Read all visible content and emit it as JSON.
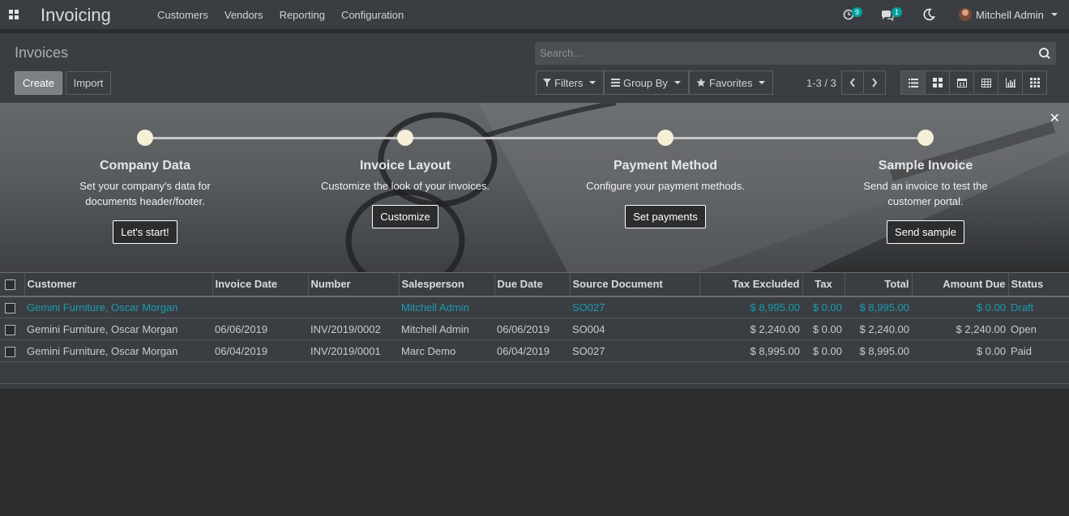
{
  "navbar": {
    "app_title": "Invoicing",
    "menu": [
      "Customers",
      "Vendors",
      "Reporting",
      "Configuration"
    ],
    "activity_count": "9",
    "message_count": "1",
    "user_name": "Mitchell Admin"
  },
  "control_panel": {
    "breadcrumb": "Invoices",
    "create_label": "Create",
    "import_label": "Import",
    "search_placeholder": "Search...",
    "filters_label": "Filters",
    "group_by_label": "Group By",
    "favorites_label": "Favorites",
    "pager": "1-3 / 3"
  },
  "onboarding": {
    "steps": [
      {
        "title": "Company Data",
        "desc": "Set your company's data for documents header/footer.",
        "button": "Let's start!"
      },
      {
        "title": "Invoice Layout",
        "desc": "Customize the look of your invoices.",
        "button": "Customize"
      },
      {
        "title": "Payment Method",
        "desc": "Configure your payment methods.",
        "button": "Set payments"
      },
      {
        "title": "Sample Invoice",
        "desc": "Send an invoice to test the customer portal.",
        "button": "Send sample"
      }
    ]
  },
  "table": {
    "columns": [
      "Customer",
      "Invoice Date",
      "Number",
      "Salesperson",
      "Due Date",
      "Source Document",
      "Tax Excluded",
      "Tax",
      "Total",
      "Amount Due",
      "Status"
    ],
    "rows": [
      [
        "Gemini Furniture, Oscar Morgan",
        "",
        "",
        "Mitchell Admin",
        "",
        "SO027",
        "$ 8,995.00",
        "$ 0.00",
        "$ 8,995.00",
        "$ 0.00",
        "Draft"
      ],
      [
        "Gemini Furniture, Oscar Morgan",
        "06/06/2019",
        "INV/2019/0002",
        "Mitchell Admin",
        "06/06/2019",
        "SO004",
        "$ 2,240.00",
        "$ 0.00",
        "$ 2,240.00",
        "$ 2,240.00",
        "Open"
      ],
      [
        "Gemini Furniture, Oscar Morgan",
        "06/04/2019",
        "INV/2019/0001",
        "Marc Demo",
        "06/04/2019",
        "SO027",
        "$ 8,995.00",
        "$ 0.00",
        "$ 8,995.00",
        "$ 0.00",
        "Paid"
      ]
    ]
  },
  "colors": {
    "accent": "#00a09d",
    "link": "#1a9bb0",
    "background": "#2a2c2d",
    "panel": "#3a3e42"
  }
}
